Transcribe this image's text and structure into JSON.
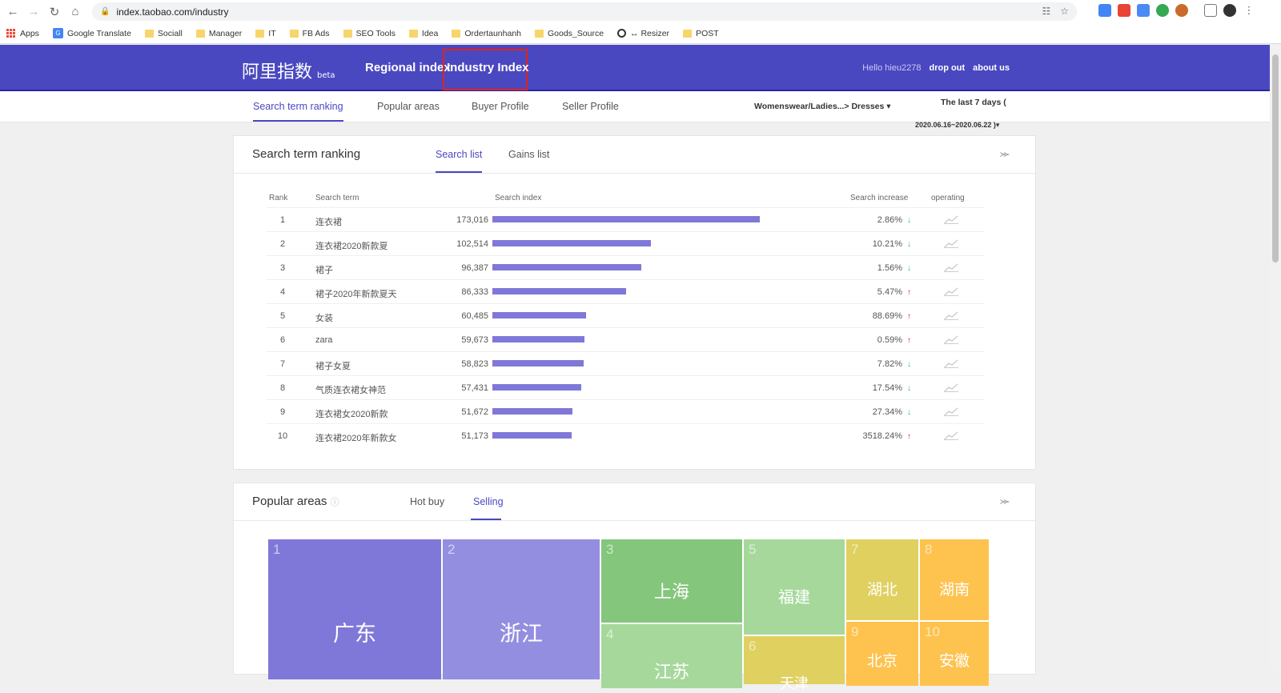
{
  "browser": {
    "url": "index.taobao.com/industry",
    "bookmarks": [
      "Apps",
      "Google Translate",
      "Sociall",
      "Manager",
      "IT",
      "FB Ads",
      "SEO Tools",
      "Idea",
      "Ordertaunhanh",
      "Goods_Source",
      "↔ Resizer",
      "POST"
    ]
  },
  "header": {
    "logo": "阿里指数",
    "logo_badge": "beta",
    "nav_regional": "Regional index",
    "nav_industry": "Industry Index",
    "hello": "Hello hieu2278",
    "drop_out": "drop out",
    "about_us": "about us"
  },
  "subnav": {
    "tabs": [
      "Search term ranking",
      "Popular areas",
      "Buyer Profile",
      "Seller Profile"
    ],
    "category": "Womenswear/Ladies...> Dresses",
    "date_label": "The last 7 days (",
    "date_range": "2020.06.16~2020.06.22 )"
  },
  "ranking": {
    "title": "Search term ranking",
    "tab_search": "Search list",
    "tab_gains": "Gains list",
    "headers": {
      "rank": "Rank",
      "term": "Search term",
      "index": "Search index",
      "increase": "Search increase",
      "operating": "operating"
    },
    "rows": [
      {
        "rank": "1",
        "term": "连衣裙",
        "index": "173,016",
        "value": 173016,
        "increase": "2.86%",
        "dir": "down"
      },
      {
        "rank": "2",
        "term": "连衣裙2020新款夏",
        "index": "102,514",
        "value": 102514,
        "increase": "10.21%",
        "dir": "down"
      },
      {
        "rank": "3",
        "term": "裙子",
        "index": "96,387",
        "value": 96387,
        "increase": "1.56%",
        "dir": "down"
      },
      {
        "rank": "4",
        "term": "裙子2020年新款夏天",
        "index": "86,333",
        "value": 86333,
        "increase": "5.47%",
        "dir": "up"
      },
      {
        "rank": "5",
        "term": "女装",
        "index": "60,485",
        "value": 60485,
        "increase": "88.69%",
        "dir": "up"
      },
      {
        "rank": "6",
        "term": "zara",
        "index": "59,673",
        "value": 59673,
        "increase": "0.59%",
        "dir": "up"
      },
      {
        "rank": "7",
        "term": "裙子女夏",
        "index": "58,823",
        "value": 58823,
        "increase": "7.82%",
        "dir": "down"
      },
      {
        "rank": "8",
        "term": "气质连衣裙女神范",
        "index": "57,431",
        "value": 57431,
        "increase": "17.54%",
        "dir": "down"
      },
      {
        "rank": "9",
        "term": "连衣裙女2020新款",
        "index": "51,672",
        "value": 51672,
        "increase": "27.34%",
        "dir": "down"
      },
      {
        "rank": "10",
        "term": "连衣裙2020年新款女",
        "index": "51,173",
        "value": 51173,
        "increase": "3518.24%",
        "dir": "up"
      }
    ]
  },
  "areas": {
    "title": "Popular areas",
    "tab_hot": "Hot buy",
    "tab_selling": "Selling",
    "tiles": [
      {
        "n": "1",
        "name": "广东"
      },
      {
        "n": "2",
        "name": "浙江"
      },
      {
        "n": "3",
        "name": "上海"
      },
      {
        "n": "4",
        "name": "江苏"
      },
      {
        "n": "5",
        "name": "福建"
      },
      {
        "n": "6",
        "name": "天津"
      },
      {
        "n": "7",
        "name": "湖北"
      },
      {
        "n": "8",
        "name": "湖南"
      },
      {
        "n": "9",
        "name": "北京"
      },
      {
        "n": "10",
        "name": "安徽"
      }
    ]
  },
  "colors": {
    "brand": "#4a48c0",
    "bar": "#8078d8",
    "highlight": "#e0231c",
    "up": "#e0231c",
    "down": "#3ab05c"
  }
}
